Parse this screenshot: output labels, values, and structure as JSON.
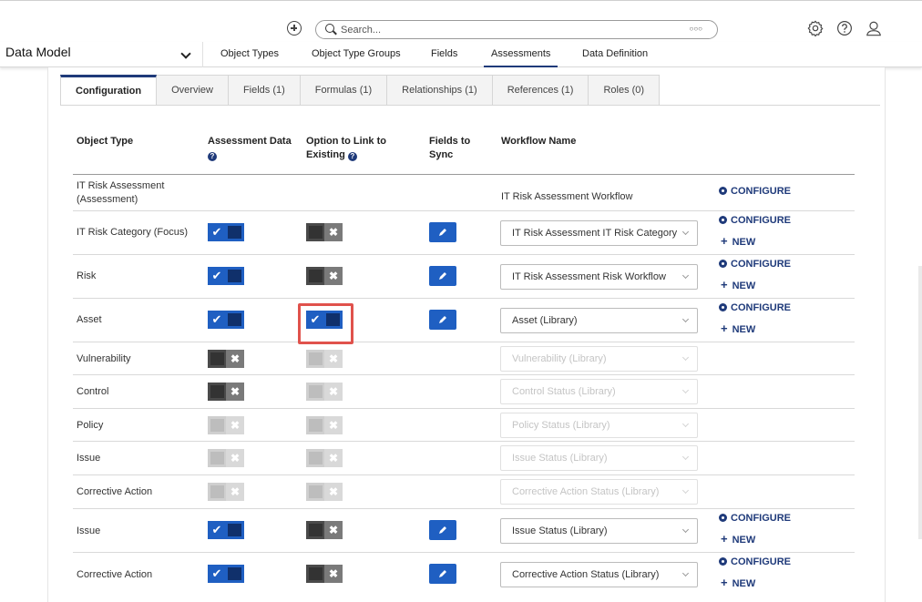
{
  "topbar": {
    "search_placeholder": "Search...",
    "icons": [
      "plus-circle-icon",
      "search-icon",
      "ellipsis-icon",
      "settings-icon",
      "help-icon",
      "user-icon"
    ]
  },
  "nav": {
    "title": "Data Model",
    "tabs": [
      "Object Types",
      "Object Type Groups",
      "Fields",
      "Assessments",
      "Data Definition"
    ],
    "active_tab": "Assessments"
  },
  "subtabs": [
    "Configuration",
    "Overview",
    "Fields (1)",
    "Formulas (1)",
    "Relationships (1)",
    "References (1)",
    "Roles (0)"
  ],
  "active_subtab": "Configuration",
  "table": {
    "headers": {
      "object_type": "Object Type",
      "assessment_data": "Assessment Data",
      "option_link_1": "Option to Link to",
      "option_link_2": "Existing",
      "fields_sync_1": "Fields to",
      "fields_sync_2": "Sync",
      "workflow": "Workflow Name"
    },
    "actions": {
      "configure": "CONFIGURE",
      "new": "NEW"
    },
    "rows": [
      {
        "type_line1": "IT Risk Assessment",
        "type_line2": "(Assessment)",
        "workflow": "IT Risk Assessment Workflow"
      },
      {
        "type": "IT Risk Category (Focus)",
        "assessment_data": "on",
        "link": "off",
        "workflow": "IT Risk Assessment IT Risk Category"
      },
      {
        "type": "Risk",
        "assessment_data": "on",
        "link": "off",
        "workflow": "IT Risk Assessment Risk Workflow"
      },
      {
        "type": "Asset",
        "assessment_data": "on",
        "link": "on",
        "workflow": "Asset (Library)"
      },
      {
        "type": "Vulnerability",
        "assessment_data": "off",
        "link": "disabled",
        "workflow": "Vulnerability (Library)"
      },
      {
        "type": "Control",
        "assessment_data": "off",
        "link": "disabled",
        "workflow": "Control Status (Library)"
      },
      {
        "type": "Policy",
        "assessment_data": "disabled",
        "link": "disabled",
        "workflow": "Policy Status (Library)"
      },
      {
        "type": "Issue",
        "assessment_data": "disabled",
        "link": "disabled",
        "workflow": "Issue Status (Library)"
      },
      {
        "type": "Corrective Action",
        "assessment_data": "disabled",
        "link": "disabled",
        "workflow": "Corrective Action Status (Library)"
      },
      {
        "type": "Issue",
        "assessment_data": "on",
        "link": "off",
        "workflow": "Issue Status (Library)"
      },
      {
        "type": "Corrective Action",
        "assessment_data": "on",
        "link": "off",
        "workflow": "Corrective Action Status (Library)"
      }
    ]
  },
  "colors": {
    "primary": "#1f5fc2",
    "navy": "#1f3a7a",
    "highlight": "#e0524c"
  }
}
